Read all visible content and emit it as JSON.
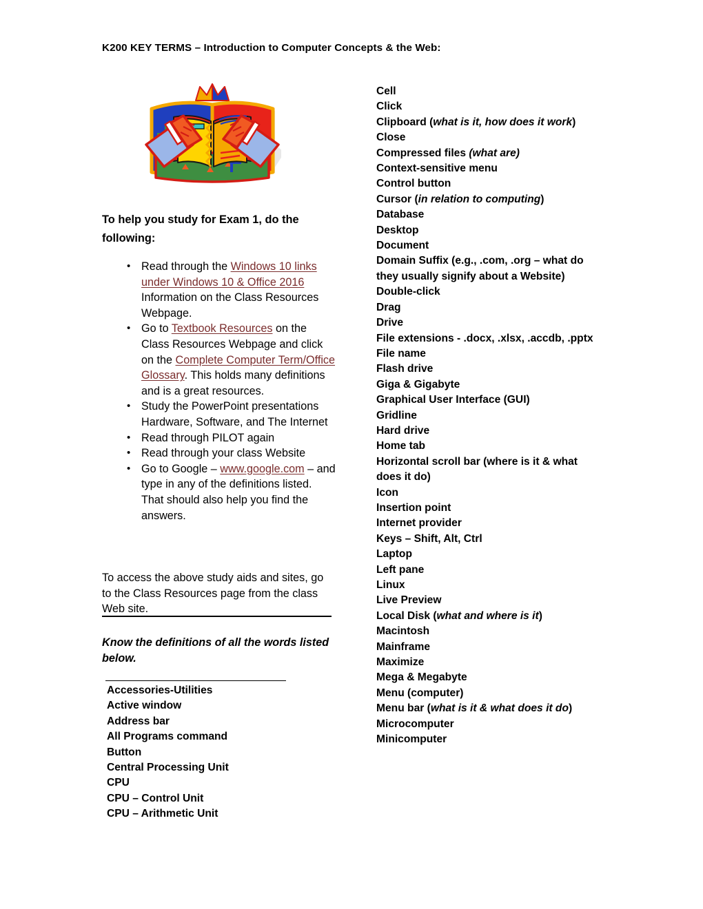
{
  "document": {
    "title": "K200 KEY TERMS – Introduction to Computer Concepts & the Web:"
  },
  "clipart": {
    "name": "open-book-with-hands-and-crown-clipart",
    "colors": {
      "red": "#E8231A",
      "blue": "#1F3FBE",
      "light_blue": "#9BB6E8",
      "yellow": "#FFD400",
      "gold": "#F5A800",
      "orange": "#F15A22",
      "green": "#3E8E41",
      "outline_red": "#D41C14"
    }
  },
  "left_column": {
    "study_heading": "To help you study for Exam 1, do the following:",
    "bullets": [
      {
        "parts": [
          {
            "text": "Read through the ",
            "type": "plain"
          },
          {
            "text": "Windows 10 links under Windows 10 & Office 2016",
            "type": "link"
          },
          {
            "text": " Information on the Class Resources Webpage.",
            "type": "plain"
          }
        ]
      },
      {
        "parts": [
          {
            "text": "Go to ",
            "type": "plain"
          },
          {
            "text": "Textbook Resources",
            "type": "link"
          },
          {
            "text": " on the Class Resources Webpage and click on the ",
            "type": "plain"
          },
          {
            "text": "Complete Computer Term/Office Glossary",
            "type": "link"
          },
          {
            "text": ". This holds many definitions and is a great resources.",
            "type": "plain"
          }
        ]
      },
      {
        "parts": [
          {
            "text": "Study the PowerPoint presentations Hardware, Software, and The Internet",
            "type": "plain"
          }
        ]
      },
      {
        "parts": [
          {
            "text": "Read through PILOT again",
            "type": "plain"
          }
        ]
      },
      {
        "parts": [
          {
            "text": "Read through your class Website",
            "type": "plain"
          }
        ]
      },
      {
        "parts": [
          {
            "text": "Go to Google – ",
            "type": "plain"
          },
          {
            "text": "www.google.com",
            "type": "link"
          },
          {
            "text": " – and type in any of the definitions listed. That should also help you find the answers.",
            "type": "plain"
          }
        ]
      }
    ],
    "access_paragraph": "To access the above study aids and sites, go to the Class Resources page from the class Web site.",
    "know_definitions_note": "Know the definitions of all the words listed below.",
    "terms": [
      {
        "text": "Accessories-Utilities"
      },
      {
        "text": "Active window"
      },
      {
        "text": "Address bar"
      },
      {
        "text": "All Programs command"
      },
      {
        "text": "Button"
      },
      {
        "text": "Central Processing Unit"
      },
      {
        "text": "CPU"
      },
      {
        "text": "CPU – Control Unit"
      },
      {
        "text": "CPU – Arithmetic Unit"
      }
    ]
  },
  "right_column": {
    "terms": [
      {
        "text": "Cell"
      },
      {
        "text": "Click"
      },
      {
        "text": "Clipboard (",
        "italic": "what is it, how does it work",
        "after": ")"
      },
      {
        "text": "Close"
      },
      {
        "text": "Compressed files ",
        "italic": "(what are)",
        "after": ""
      },
      {
        "text": "Context-sensitive menu"
      },
      {
        "text": "Control button"
      },
      {
        "text": "Cursor (",
        "italic": "in relation to computing",
        "after": ")"
      },
      {
        "text": "Database"
      },
      {
        "text": "Desktop"
      },
      {
        "text": "Document"
      },
      {
        "text": "Domain Suffix (e.g., .com, .org – what do they usually signify about a Website)"
      },
      {
        "text": "Double-click"
      },
      {
        "text": "Drag"
      },
      {
        "text": "Drive"
      },
      {
        "text": "File extensions - .docx, .xlsx, .accdb, .pptx"
      },
      {
        "text": "File name"
      },
      {
        "text": "Flash drive"
      },
      {
        "text": "Giga & Gigabyte"
      },
      {
        "text": "Graphical User Interface (GUI)"
      },
      {
        "text": "Gridline"
      },
      {
        "text": "Hard drive"
      },
      {
        "text": "Home tab"
      },
      {
        "text": "Horizontal scroll bar (where is it & what does it do)"
      },
      {
        "text": "Icon"
      },
      {
        "text": "Insertion point"
      },
      {
        "text": "Internet provider"
      },
      {
        "text": "Keys – Shift, Alt, Ctrl"
      },
      {
        "text": "Laptop"
      },
      {
        "text": "Left pane"
      },
      {
        "text": "Linux"
      },
      {
        "text": "Live Preview"
      },
      {
        "text": "Local Disk (",
        "italic": "what and where is it",
        "after": ")"
      },
      {
        "text": "Macintosh"
      },
      {
        "text": "Mainframe"
      },
      {
        "text": "Maximize"
      },
      {
        "text": "Mega & Megabyte"
      },
      {
        "text": "Menu (computer)"
      },
      {
        "text": "Menu bar (",
        "italic": "what is it & what does it do",
        "after": ")"
      },
      {
        "text": "Microcomputer"
      },
      {
        "text": "Minicomputer"
      }
    ]
  },
  "colors": {
    "link": "#7A2D2D",
    "text": "#000000",
    "background": "#FFFFFF"
  }
}
